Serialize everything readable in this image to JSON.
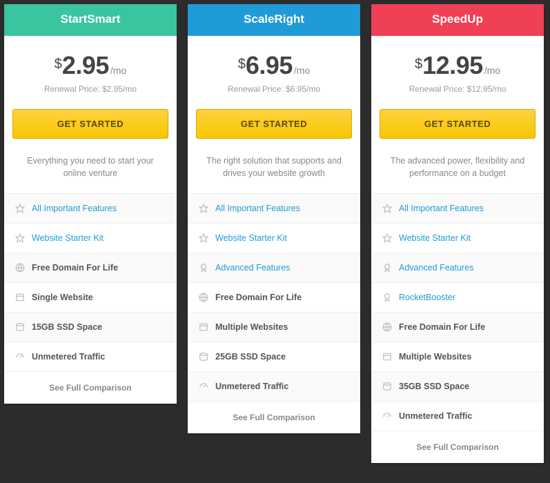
{
  "common": {
    "currency": "$",
    "per": "/mo",
    "cta_label": "GET STARTED",
    "see_full_label": "See Full Comparison"
  },
  "plans": [
    {
      "name": "StartSmart",
      "header_color": "#3bc4a0",
      "price": "2.95",
      "renewal": "Renewal Price: $2.95/mo",
      "tagline": "Everything you need to start your online venture",
      "features": [
        {
          "icon": "star",
          "label": "All Important Features",
          "link": true
        },
        {
          "icon": "star",
          "label": "Website Starter Kit",
          "link": true
        },
        {
          "icon": "globe",
          "label": "Free Domain For Life",
          "link": false
        },
        {
          "icon": "site",
          "label": "Single Website",
          "link": false
        },
        {
          "icon": "disk",
          "label": "15GB SSD Space",
          "link": false
        },
        {
          "icon": "gauge",
          "label": "Unmetered Traffic",
          "link": false
        }
      ]
    },
    {
      "name": "ScaleRight",
      "header_color": "#1f9bd8",
      "price": "6.95",
      "renewal": "Renewal Price: $6.95/mo",
      "tagline": "The right solution that supports and drives your website growth",
      "features": [
        {
          "icon": "star",
          "label": "All Important Features",
          "link": true
        },
        {
          "icon": "star",
          "label": "Website Starter Kit",
          "link": true
        },
        {
          "icon": "badge",
          "label": "Advanced Features",
          "link": true
        },
        {
          "icon": "globe",
          "label": "Free Domain For Life",
          "link": false
        },
        {
          "icon": "site",
          "label": "Multiple Websites",
          "link": false
        },
        {
          "icon": "disk",
          "label": "25GB SSD Space",
          "link": false
        },
        {
          "icon": "gauge",
          "label": "Unmetered Traffic",
          "link": false
        }
      ]
    },
    {
      "name": "SpeedUp",
      "header_color": "#ef4056",
      "price": "12.95",
      "renewal": "Renewal Price: $12.95/mo",
      "tagline": "The advanced power, flexibility and performance on a budget",
      "features": [
        {
          "icon": "star",
          "label": "All Important Features",
          "link": true
        },
        {
          "icon": "star",
          "label": "Website Starter Kit",
          "link": true
        },
        {
          "icon": "badge",
          "label": "Advanced Features",
          "link": true
        },
        {
          "icon": "badge",
          "label": "RocketBooster",
          "link": true
        },
        {
          "icon": "globe",
          "label": "Free Domain For Life",
          "link": false
        },
        {
          "icon": "site",
          "label": "Multiple Websites",
          "link": false
        },
        {
          "icon": "disk",
          "label": "35GB SSD Space",
          "link": false
        },
        {
          "icon": "gauge",
          "label": "Unmetered Traffic",
          "link": false
        }
      ]
    }
  ]
}
